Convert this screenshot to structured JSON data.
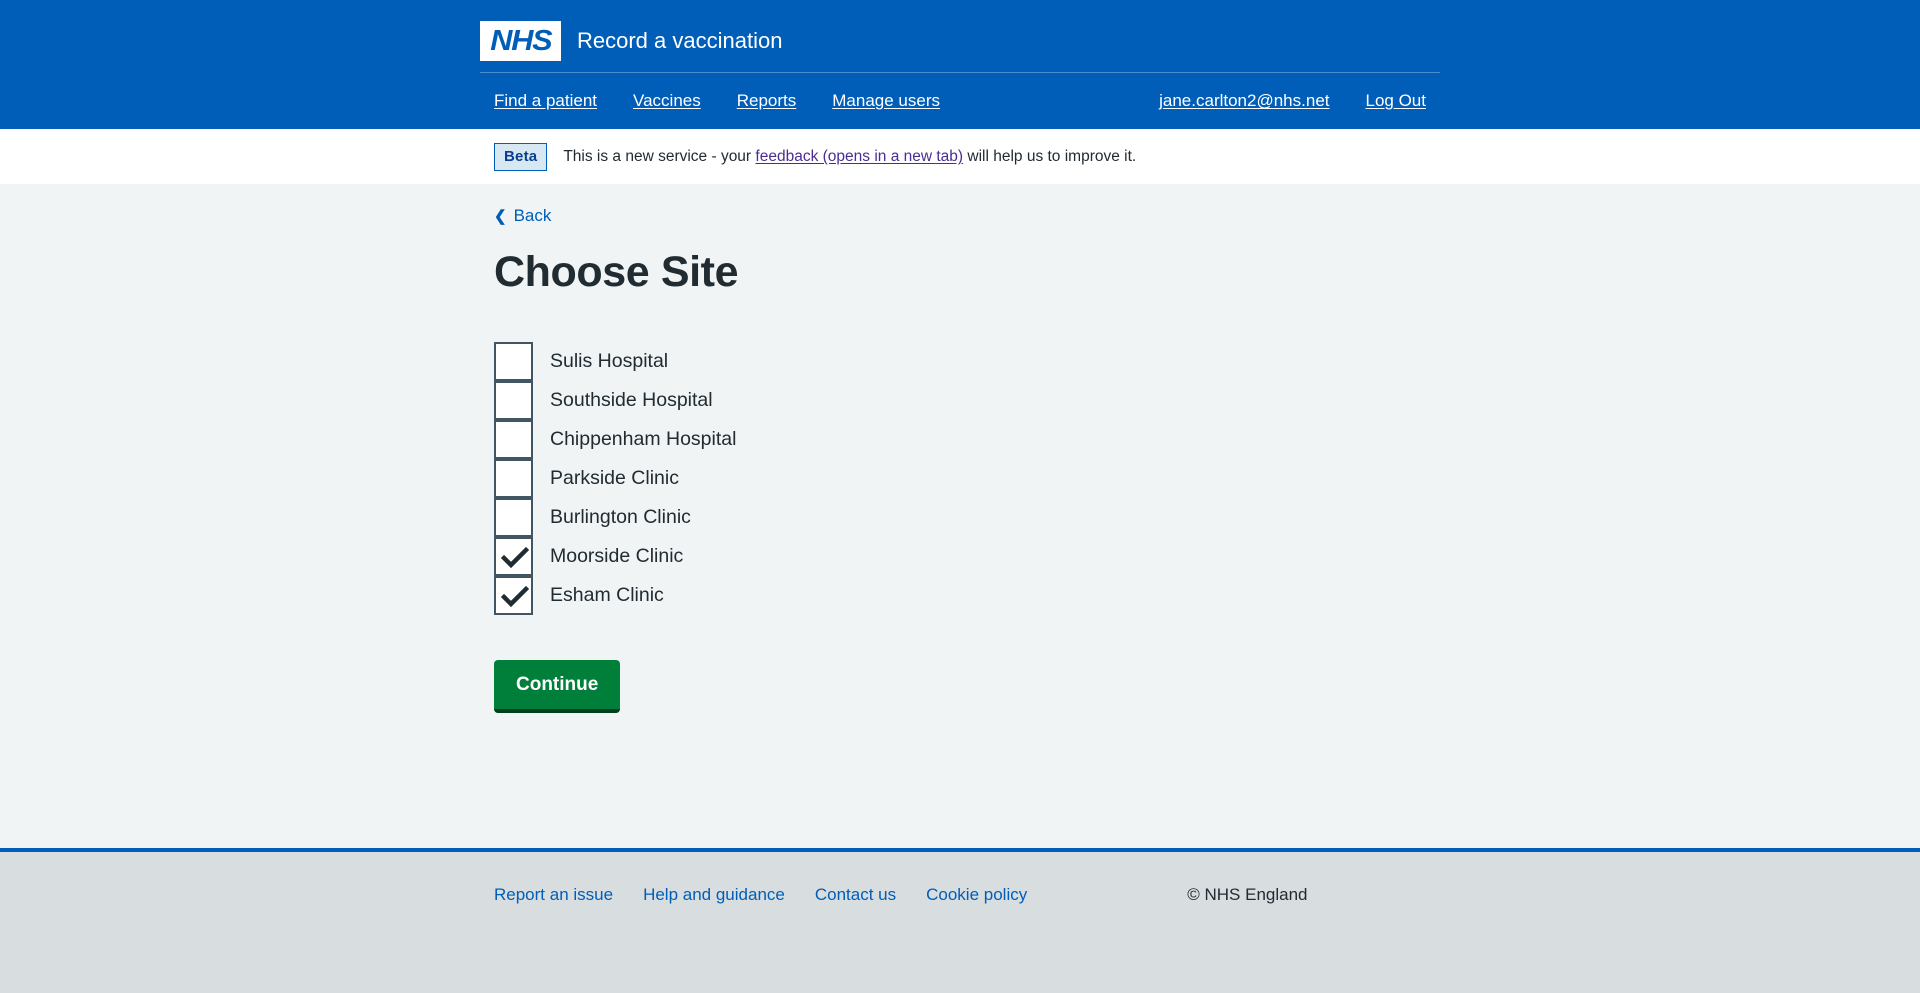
{
  "header": {
    "logo_text": "NHS",
    "service_name": "Record a vaccination",
    "nav_primary": [
      {
        "label": "Find a patient"
      },
      {
        "label": "Vaccines"
      },
      {
        "label": "Reports"
      },
      {
        "label": "Manage users"
      }
    ],
    "nav_account": [
      {
        "label": "jane.carlton2@nhs.net"
      },
      {
        "label": "Log Out"
      }
    ]
  },
  "beta_banner": {
    "tag": "Beta",
    "text_before": "This is a new service - your ",
    "link": "feedback (opens in a new tab)",
    "text_after": " will help us to improve it."
  },
  "main": {
    "back_label": "Back",
    "back_chevron": "chevron-left-icon",
    "title": "Choose Site",
    "sites": [
      {
        "label": "Sulis Hospital",
        "checked": false
      },
      {
        "label": "Southside Hospital",
        "checked": false
      },
      {
        "label": "Chippenham Hospital",
        "checked": false
      },
      {
        "label": "Parkside Clinic",
        "checked": false
      },
      {
        "label": "Burlington Clinic",
        "checked": false
      },
      {
        "label": "Moorside Clinic",
        "checked": true
      },
      {
        "label": "Esham Clinic",
        "checked": true
      }
    ],
    "continue_label": "Continue"
  },
  "footer": {
    "links": [
      {
        "label": "Report an issue"
      },
      {
        "label": "Help and guidance"
      },
      {
        "label": "Contact us"
      },
      {
        "label": "Cookie policy"
      }
    ],
    "copyright": "© NHS England"
  },
  "colors": {
    "nhs_blue": "#005eb8",
    "page_background": "#f0f4f5",
    "footer_background": "#d8dde0",
    "green_button": "#007f3b",
    "text": "#212b32",
    "visited_link": "#4c2c92"
  }
}
